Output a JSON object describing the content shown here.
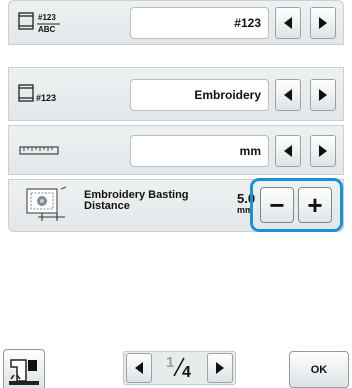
{
  "settings": {
    "rows": [
      {
        "name": "thread-number-display",
        "icon": "thread-number-abc-icon",
        "icon_text_top": "#123",
        "icon_text_bottom": "ABC",
        "value": "#123"
      },
      {
        "name": "thread-color-display",
        "icon": "thread-number-icon",
        "icon_text": "#123",
        "value": "Embroidery"
      },
      {
        "name": "embroidery-unit",
        "icon": "ruler-icon",
        "value": "mm"
      }
    ],
    "basting": {
      "label": "Embroidery Basting Distance",
      "value": "5.0",
      "unit": "mm",
      "minus_label": "−",
      "plus_label": "+"
    }
  },
  "footer": {
    "pager": {
      "current": "1",
      "total": "4"
    },
    "ok_label": "OK"
  },
  "colors": {
    "highlight": "#1793d6",
    "panel": "#e6eaec"
  }
}
